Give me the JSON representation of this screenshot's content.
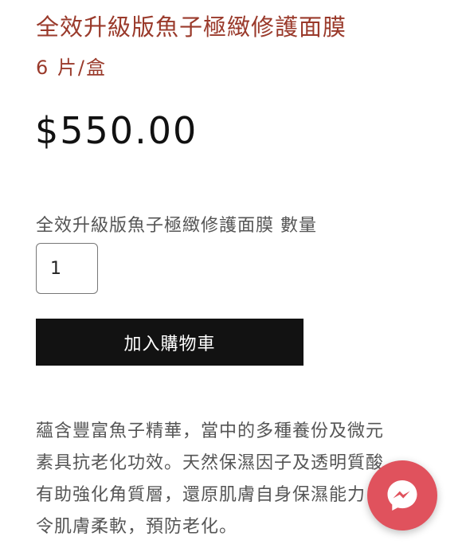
{
  "product": {
    "title": "全效升級版魚子極緻修護面膜",
    "subtitle": "6 片/盒",
    "price": "$550.00"
  },
  "quantity": {
    "label": "全效升級版魚子極緻修護面膜 數量",
    "value": "1"
  },
  "cart": {
    "add_label": "加入購物車"
  },
  "description": {
    "lines": [
      "蘊含豐富魚子精華，當中的多種養份及微元",
      "素具抗老化功效。天然保濕因子及透明質酸",
      "有助強化角質層，還原肌膚自身保濕能力，",
      "令肌膚柔軟，預防老化。"
    ]
  },
  "chat": {
    "icon": "messenger-icon",
    "color": "#e0525d"
  }
}
